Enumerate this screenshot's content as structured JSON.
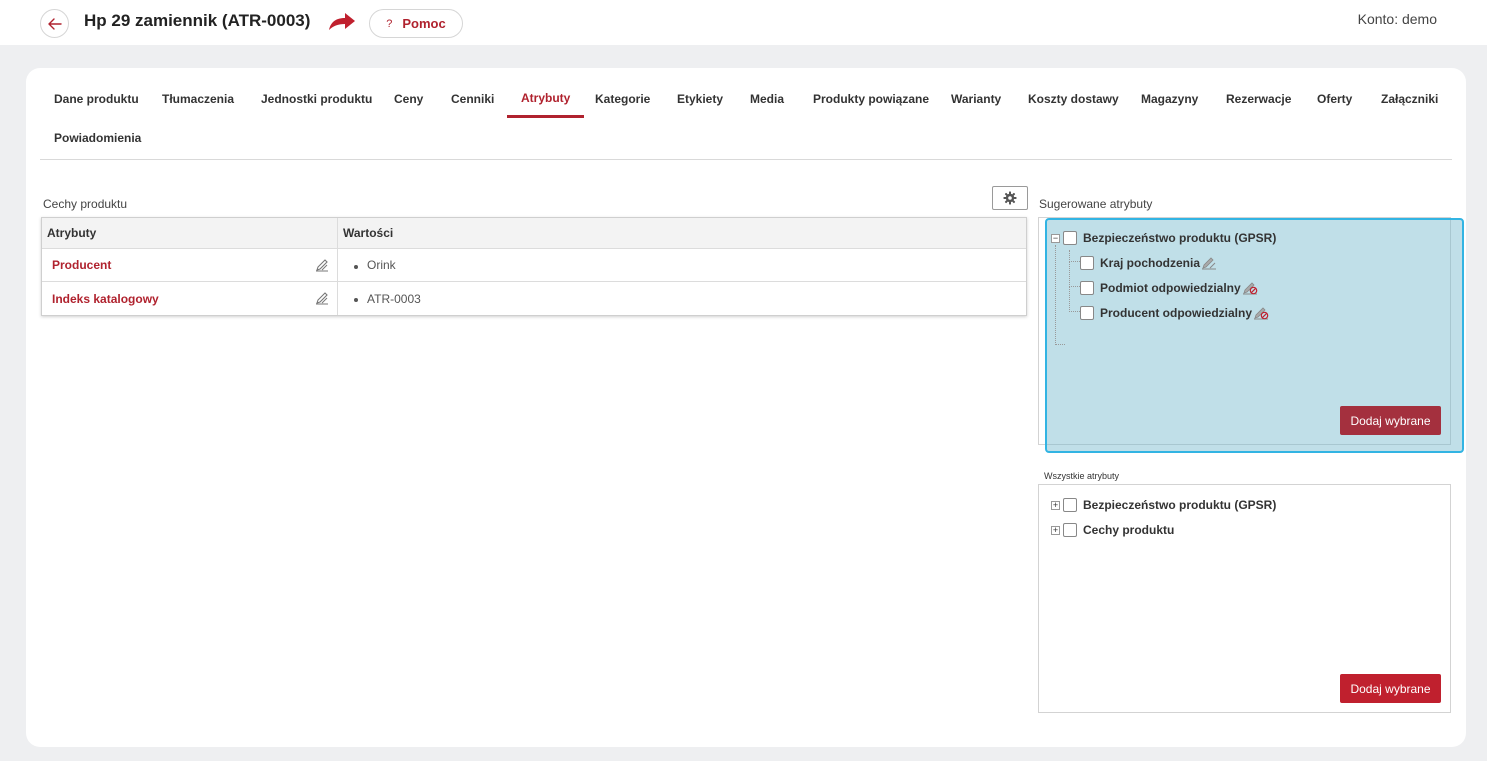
{
  "header": {
    "title": "Hp 29 zamiennik (ATR-0003)",
    "help_q": "?",
    "help_label": "Pomoc",
    "account": "Konto: demo"
  },
  "tabs": [
    "Dane produktu",
    "Tłumaczenia",
    "Jednostki produktu",
    "Ceny",
    "Cenniki",
    "Atrybuty",
    "Kategorie",
    "Etykiety",
    "Media",
    "Produkty powiązane",
    "Warianty",
    "Koszty dostawy",
    "Magazyny",
    "Rezerwacje",
    "Oferty",
    "Załączniki",
    "Powiadomienia"
  ],
  "active_tab": "Atrybuty",
  "left": {
    "section_title": "Cechy produktu",
    "table": {
      "headers": [
        "Atrybuty",
        "Wartości"
      ],
      "rows": [
        {
          "name": "Producent",
          "value": "Orink"
        },
        {
          "name": "Indeks katalogowy",
          "value": "ATR-0003"
        }
      ]
    }
  },
  "suggested": {
    "title": "Sugerowane atrybuty",
    "root": "Bezpieczeństwo produktu (GPSR)",
    "root_expander": "−",
    "children": [
      "Kraj pochodzenia",
      "Podmiot odpowiedzialny",
      "Producent odpowiedzialny"
    ],
    "button": "Dodaj wybrane"
  },
  "all": {
    "title": "Wszystkie atrybuty",
    "items": [
      "Bezpieczeństwo produktu (GPSR)",
      "Cechy produktu"
    ],
    "expander": "+",
    "button": "Dodaj wybrane"
  },
  "colors": {
    "accent": "#b0222e",
    "highlight": "#32b4e3",
    "button_dim": "#a4303e",
    "button": "#c0202e"
  },
  "icons": [
    "back-arrow-icon",
    "share-arrow-icon",
    "gear-icon",
    "edit-icon",
    "attribute-icon",
    "attribute-disabled-icon"
  ]
}
